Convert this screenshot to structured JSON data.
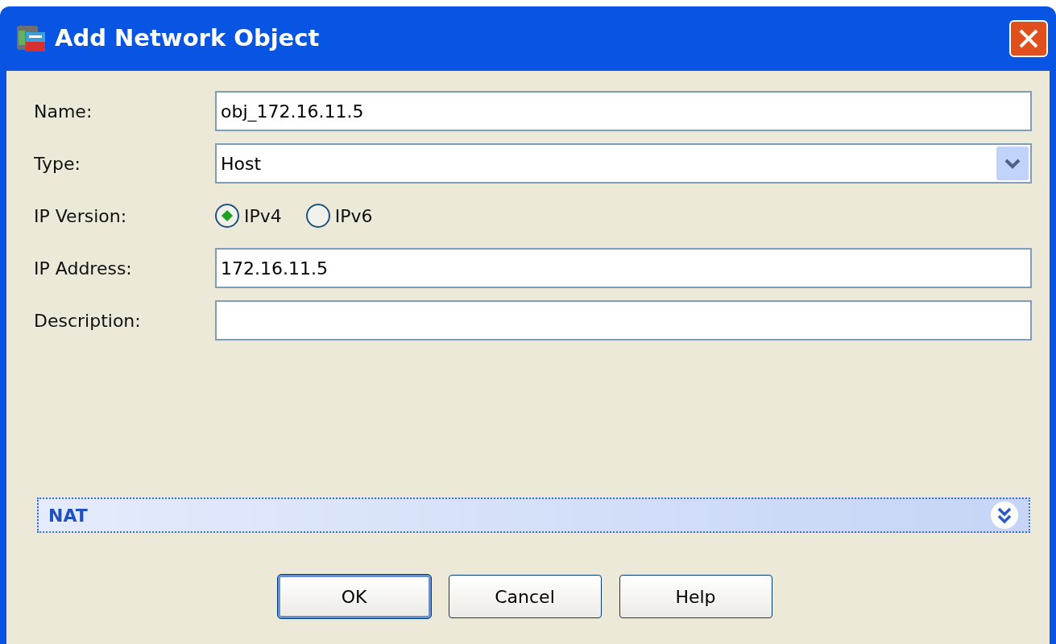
{
  "window": {
    "title": "Add Network Object"
  },
  "fields": [
    {
      "kind": "text",
      "label": "Name:",
      "value": "obj_172.16.11.5"
    },
    {
      "kind": "select",
      "label": "Type:",
      "value": "Host"
    },
    {
      "kind": "radio",
      "label": "IP Version:",
      "options": [
        {
          "label": "IPv4",
          "selected": true
        },
        {
          "label": "IPv6",
          "selected": false
        }
      ]
    },
    {
      "kind": "text",
      "label": "IP Address:",
      "value": "172.16.11.5"
    },
    {
      "kind": "text",
      "label": "Description:"
    }
  ],
  "nat_section": {
    "title": "NAT",
    "expanded": false
  },
  "buttons": [
    {
      "label": "OK",
      "default": true
    },
    {
      "label": "Cancel",
      "default": false
    },
    {
      "label": "Help",
      "default": false
    }
  ]
}
